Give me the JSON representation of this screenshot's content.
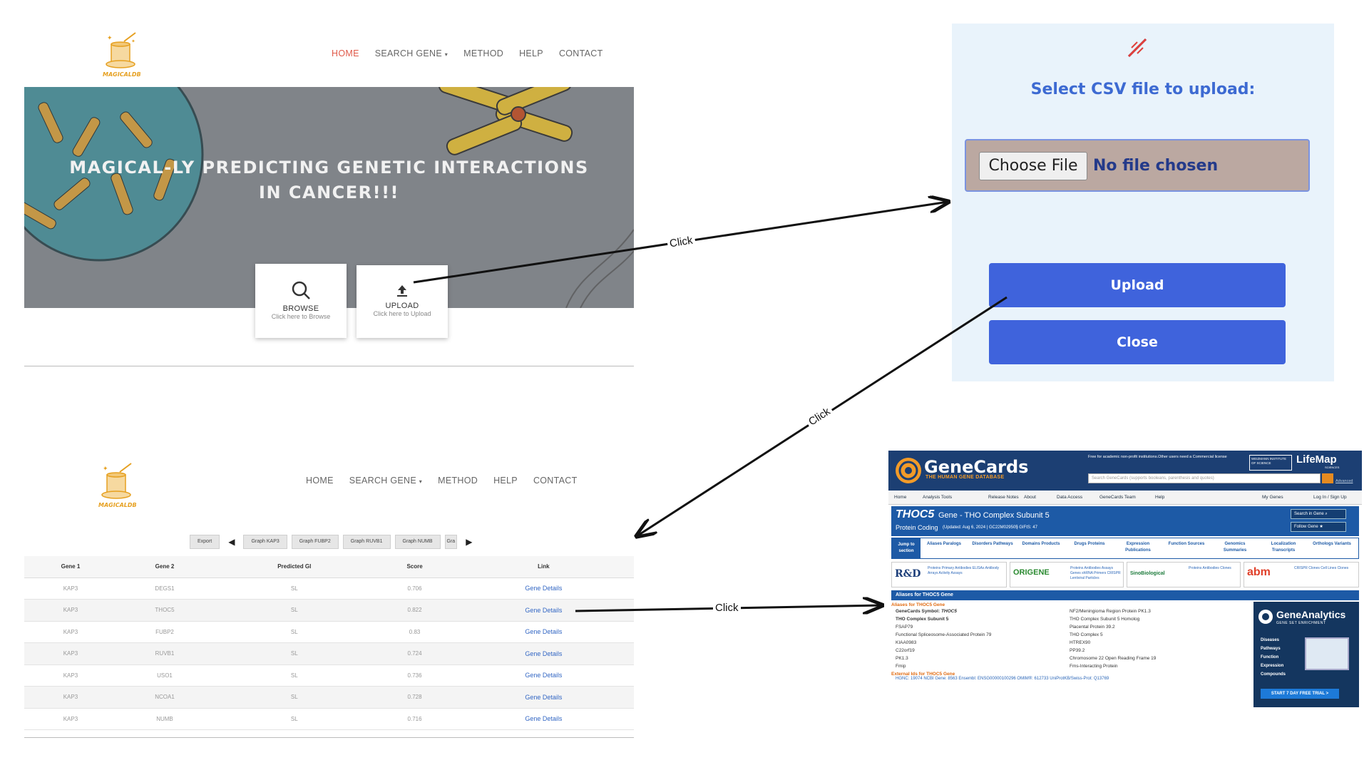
{
  "home": {
    "logo_text": "MAGICALDB",
    "nav": [
      "HOME",
      "SEARCH GENE",
      "METHOD",
      "HELP",
      "CONTACT"
    ],
    "hero_line1": "MAGICAL-LY PREDICTING GENETIC INTERACTIONS",
    "hero_line2": "IN CANCER!!!",
    "browse": {
      "label": "BROWSE",
      "sub": "Click here to Browse"
    },
    "upload": {
      "label": "UPLOAD",
      "sub": "Click here to Upload"
    }
  },
  "upload_dialog": {
    "title": "Select CSV file to upload:",
    "choose_file": "Choose File",
    "no_file": "No file chosen",
    "upload_label": "Upload",
    "close_label": "Close"
  },
  "results": {
    "logo_text": "MAGICALDB",
    "nav": [
      "HOME",
      "SEARCH GENE",
      "METHOD",
      "HELP",
      "CONTACT"
    ],
    "toolbar": [
      "Export",
      "Graph KAP3",
      "Graph FUBP2",
      "Graph RUVB1",
      "Graph NUMB",
      "Gra"
    ],
    "columns": [
      "Gene 1",
      "Gene 2",
      "Predicted GI",
      "Score",
      "Link"
    ],
    "rows": [
      [
        "KAP3",
        "DEGS1",
        "SL",
        "0.706",
        "Gene Details"
      ],
      [
        "KAP3",
        "THOC5",
        "SL",
        "0.822",
        "Gene Details"
      ],
      [
        "KAP3",
        "FUBP2",
        "SL",
        "0.83",
        "Gene Details"
      ],
      [
        "KAP3",
        "RUVB1",
        "SL",
        "0.724",
        "Gene Details"
      ],
      [
        "KAP3",
        "USO1",
        "SL",
        "0.736",
        "Gene Details"
      ],
      [
        "KAP3",
        "NCOA1",
        "SL",
        "0.728",
        "Gene Details"
      ],
      [
        "KAP3",
        "NUMB",
        "SL",
        "0.716",
        "Gene Details"
      ]
    ]
  },
  "genecards": {
    "brand": "GeneCards",
    "tagline": "THE HUMAN GENE DATABASE",
    "free_note": "Free for academic non-profit institutions.Other users need a Commercial license",
    "weizmann": "WEIZMANN INSTITUTE OF SCIENCE",
    "lifemap": "LifeMap",
    "lifemap_sub": "SCIENCES",
    "search_placeholder": "Search GeneCards (supports booleans, parenthesis and quotes)",
    "advanced": "Advanced",
    "nav": [
      "Home",
      "Analysis Tools",
      "Release Notes",
      "About",
      "Data Access",
      "GeneCards Team",
      "Help",
      "My Genes",
      "Log In / Sign Up"
    ],
    "symbol": "THOC5",
    "gene_word": "Gene",
    "gene_name": "- THO Complex Subunit 5",
    "subtitle": "Protein Coding",
    "updated": "(Updated: Aug 6, 2024 | GC22M029505",
    "gifts": "| GIFtS: 47",
    "search_in_gene": "Search in Gene",
    "follow_gene": "Follow Gene",
    "jump_to": "Jump to section",
    "sections": [
      "Aliases Paralogs",
      "Disorders Pathways",
      "Domains Products",
      "Drugs Proteins",
      "Expression Publications",
      "Function Sources",
      "Genomics Summaries",
      "Localization Transcripts",
      "Orthologs Variants"
    ],
    "ads": [
      {
        "name": "R&D",
        "desc": "Proteins Primary Antibodies ELISAs Antibody Arrays Activity Assays"
      },
      {
        "name": "ORIGENE",
        "desc": "Proteins Antibodies Assays Genes shRNA Primers CRISPR Lentiviral Particles"
      },
      {
        "name": "SinoBiological",
        "desc": "Proteins Antibodies Clones"
      },
      {
        "name": "abm",
        "desc": "CRISPR Clones Cell Lines Clones"
      }
    ],
    "aliases_bar": "Aliases for THOC5 Gene",
    "aliases_heading": "Aliases for THOC5 Gene",
    "alias_symbol_label": "GeneCards Symbol:",
    "alias_symbol": "THOC5",
    "aliases_left": [
      "THO Complex Subunit 5",
      "FSAP79",
      "Functional Spliceosome-Associated Protein 79",
      "KIAA0983",
      "C22orf19",
      "PK1.3",
      "Fmip"
    ],
    "aliases_right": [
      "NF2/Meningioma Region Protein PK1.3",
      "THO Complex Subunit 5 Homolog",
      "Placental Protein 39.2",
      "THO Complex 5",
      "HTREX90",
      "PP39.2",
      "Chromosome 22 Open Reading Frame 19",
      "Fms-Interacting Protein"
    ],
    "external_heading": "External Ids for THOC5 Gene",
    "external_ids": "HGNC: 19074  NCBI Gene: 8563  Ensembl: ENSG00000100296  OMIM®: 612733  UniProtKB/Swiss-Prot: Q13769",
    "ga_brand": "GeneAnalytics",
    "ga_sub": "GENE SET ENRICHMENT",
    "ga_items": [
      "Diseases",
      "Pathways",
      "Function",
      "Expression",
      "Compounds"
    ],
    "ga_cta": "START 7 DAY FREE TRIAL >"
  },
  "annotations": [
    "Click",
    "Click",
    "Click"
  ],
  "colors": {
    "accent_red": "#e05a4a",
    "upload_blue": "#3f63dc",
    "gc_navy": "#1c3f73",
    "gc_blue": "#1d5aa6",
    "gc_orange": "#f39b28"
  }
}
